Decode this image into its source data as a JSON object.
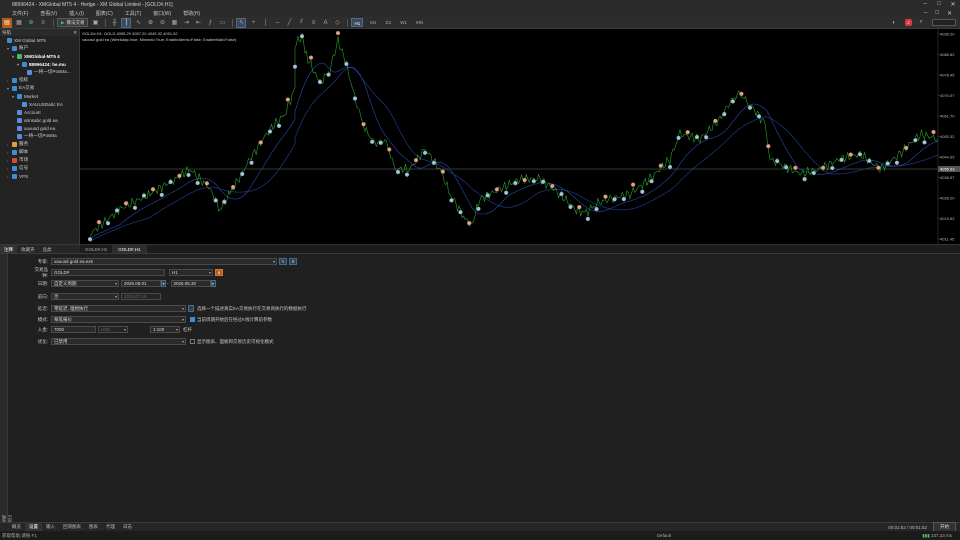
{
  "window": {
    "title": "88996424 - XMGlobal MT5 4 - Hedge - XM Global Limited - [GOLD#,H1]",
    "controls": [
      "–",
      "□",
      "✕"
    ]
  },
  "menu": {
    "items": [
      "文件(F)",
      "查看(V)",
      "插入(I)",
      "图表(C)",
      "工具(T)",
      "窗口(W)",
      "帮助(H)"
    ],
    "right": [
      "–",
      "□",
      "✕"
    ]
  },
  "toolbar": {
    "algo_label": "算法交易",
    "timeframes": [
      "H1",
      "M1",
      "D1",
      "W1",
      "MN"
    ],
    "active_timeframe": "H1",
    "notification_count": "2"
  },
  "navigator": {
    "title": "导航",
    "rows": [
      {
        "label": "XM Global MT5",
        "indent": 0,
        "arrow": "",
        "icon": "globe-icon",
        "color": "#3a8ed8",
        "bold": false
      },
      {
        "label": "账户",
        "indent": 1,
        "arrow": "▾",
        "icon": "folder-icon",
        "color": "#3a8ed8",
        "bold": false
      },
      {
        "label": "XMGlobal-MT5 4",
        "indent": 2,
        "arrow": "▾",
        "icon": "server-icon",
        "color": "#3fbf5f",
        "bold": true
      },
      {
        "label": "88996424: he.mu",
        "indent": 3,
        "arrow": "▾",
        "icon": "account-icon",
        "color": "#3a8ed8",
        "bold": true
      },
      {
        "label": "一将一切PosMa...",
        "indent": 4,
        "arrow": "",
        "icon": "ea-icon",
        "color": "#5a8ad8",
        "bold": false
      },
      {
        "label": "指标",
        "indent": 1,
        "arrow": "›",
        "icon": "indicator-icon",
        "color": "#3a8ed8",
        "bold": false
      },
      {
        "label": "EA交易",
        "indent": 1,
        "arrow": "▾",
        "icon": "folder-icon",
        "color": "#3a8ed8",
        "bold": false
      },
      {
        "label": "Market",
        "indent": 2,
        "arrow": "▾",
        "icon": "market-icon",
        "color": "#3a8ed8",
        "bold": false
      },
      {
        "label": "XAUUSDabc EA",
        "indent": 3,
        "arrow": "",
        "icon": "ea-icon",
        "color": "#5a8ad8",
        "bold": false
      },
      {
        "label": "Account",
        "indent": 2,
        "arrow": "",
        "icon": "ea-icon",
        "color": "#5a8ad8",
        "bold": false
      },
      {
        "label": "atmsabc gold ea",
        "indent": 2,
        "arrow": "",
        "icon": "ea-icon",
        "color": "#5a8ad8",
        "bold": false
      },
      {
        "label": "xauusd gold ea",
        "indent": 2,
        "arrow": "",
        "icon": "ea-icon",
        "color": "#5a8ad8",
        "bold": false
      },
      {
        "label": "一将一切PosMa",
        "indent": 2,
        "arrow": "",
        "icon": "ea-icon",
        "color": "#5a8ad8",
        "bold": false
      },
      {
        "label": "服务",
        "indent": 1,
        "arrow": "›",
        "icon": "service-icon",
        "color": "#d8a03a",
        "bold": false
      },
      {
        "label": "脚本",
        "indent": 1,
        "arrow": "›",
        "icon": "script-icon",
        "color": "#3a8ed8",
        "bold": false
      },
      {
        "label": "市场",
        "indent": 1,
        "arrow": "›",
        "icon": "market-icon",
        "color": "#d84a3a",
        "bold": false
      },
      {
        "label": "信号",
        "indent": 1,
        "arrow": "›",
        "icon": "signal-icon",
        "color": "#3a8ed8",
        "bold": false
      },
      {
        "label": "VPS",
        "indent": 1,
        "arrow": "›",
        "icon": "vps-icon",
        "color": "#3a8ed8",
        "bold": false
      }
    ],
    "tabs": [
      "注释",
      "收藏夹",
      "品类"
    ]
  },
  "chart": {
    "symbol_line": "GOLD#,H1: GOLD 4055.20 4057.20 4049.32 4051.92",
    "ea_line": "xauusd gold ea (Weekday=true; Minimal=True; EnableAlerts=False; EnableMail=False)",
    "price_labels": [
      "4095.20",
      "4086.82",
      "4078.45",
      "4070.07",
      "4061.70",
      "4053.32",
      "4044.95",
      "4036.57",
      "4028.20",
      "4019.82",
      "4011.45"
    ],
    "current_price_tag": "4055.93",
    "tabs": [
      "GOLD#,H1",
      "GOLD#,H1"
    ],
    "active_tab": "GOLD#,H1",
    "colors": {
      "line": "#2aa12a",
      "ma1": "#1e3a8c",
      "ma2": "#2a4ab0",
      "buy_marker": "#a0c8d8",
      "sell_marker": "#e8a080",
      "price_line": "#888888"
    }
  },
  "tester": {
    "expert_label": "专家:",
    "expert_value": "xauusd gold ea.ex5",
    "symbol_label": "交易品种:",
    "symbol_value": "GOLD#",
    "period_value": "H1",
    "date_label": "日期:",
    "date_mode": "自定义周期",
    "date_from": "2026.08.01",
    "date_to": "2026.05.30",
    "forward_label": "前向:",
    "forward_value": "否",
    "forward_date": "2026.07.16",
    "delay_label": "延迟:",
    "delay_value": "零延迟, 理想执行",
    "delay_note": "选择一个描述真实EA交易执行在交易商执行的数据执行",
    "model_label": "模式:",
    "model_value": "每笔报价",
    "model_note": "当前周期开始后在经过K线计算前参数",
    "deposit_label": "入金:",
    "deposit_value": "7000",
    "currency_value": "USD",
    "leverage_value": "1:100",
    "leverage_note": "杠杆",
    "optimization_label": "优化:",
    "optimization_value": "已禁用",
    "optimization_note": "显示图表、面板和交易历史可视化模式",
    "side_label": "策略测试"
  },
  "bottom_tabs": {
    "tabs": [
      "概览",
      "设置",
      "输入",
      "回测图表",
      "图表",
      "代理",
      "日志"
    ],
    "active": "设置",
    "timer": "00:01:52 / 00:01:52",
    "start": "开始"
  },
  "statusbar": {
    "help": "获取帮助,请按 F1",
    "profile": "Default",
    "ping": "237.23 ms"
  }
}
